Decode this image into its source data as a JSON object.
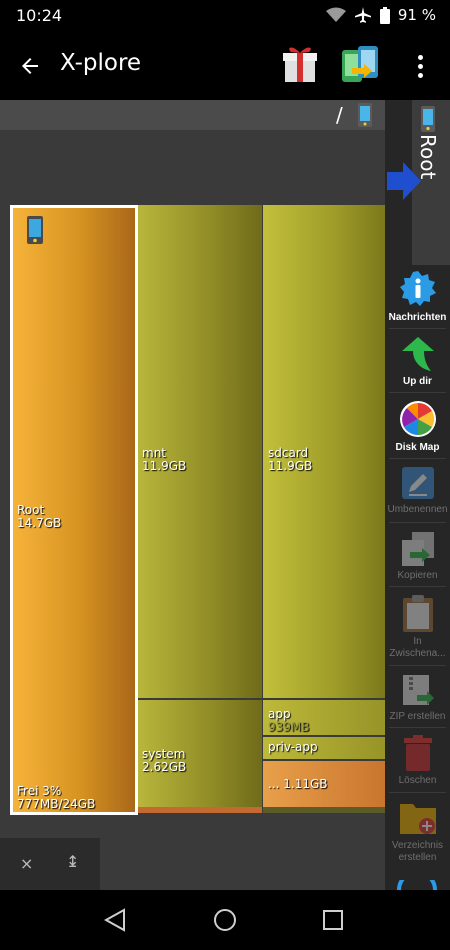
{
  "status_bar": {
    "time": "10:24",
    "battery_text": "91 %",
    "icons": [
      "wifi-icon",
      "airplane-icon",
      "battery-icon"
    ]
  },
  "app_bar": {
    "title": "X-plore",
    "back_icon": "arrow-left-icon",
    "gift_icon": "gift-icon",
    "dual_pane_icon": "dual-pane-icon",
    "menu_icon": "more-vert-icon"
  },
  "path_bar": {
    "separator": "/"
  },
  "disk_map": {
    "root": {
      "name": "Root",
      "size": "14.7GB",
      "free_label": "Frei 3%",
      "free_detail": "777MB/24GB"
    },
    "mnt": {
      "name": "mnt",
      "size": "11.9GB"
    },
    "system": {
      "name": "system",
      "size": "2.62GB"
    },
    "sdcard": {
      "name": "sdcard",
      "size": "11.9GB"
    },
    "app": {
      "name": "app",
      "size": "939MB"
    },
    "priv_app": {
      "name": "priv-app"
    },
    "other": {
      "name": "...",
      "size": "1.11GB"
    }
  },
  "bottom_bar": {
    "close_glyph": "×",
    "expand_glyph": "↨"
  },
  "side_tab": {
    "label": "Root"
  },
  "toolbar": {
    "items": [
      {
        "label": "Nachrichten",
        "icon": "info-badge-icon",
        "enabled": true
      },
      {
        "label": "Up dir",
        "icon": "up-arrow-icon",
        "enabled": true
      },
      {
        "label": "Disk Map",
        "icon": "pie-chart-icon",
        "enabled": true
      },
      {
        "label": "Umbenennen",
        "icon": "rename-icon",
        "enabled": false
      },
      {
        "label": "Kopieren",
        "icon": "copy-icon",
        "enabled": false
      },
      {
        "label": "In Zwischena...",
        "icon": "clipboard-icon",
        "enabled": false
      },
      {
        "label": "ZIP erstellen",
        "icon": "zip-icon",
        "enabled": false
      },
      {
        "label": "Löschen",
        "icon": "trash-icon",
        "enabled": false
      },
      {
        "label": "Verzeichnis erstellen",
        "icon": "new-folder-icon",
        "enabled": false
      }
    ]
  },
  "colors": {
    "root_tile": "#e3a12a",
    "folder_tile": "#9e9b28",
    "other_tile": "#d9853a",
    "selection_border": "#ffffff"
  }
}
